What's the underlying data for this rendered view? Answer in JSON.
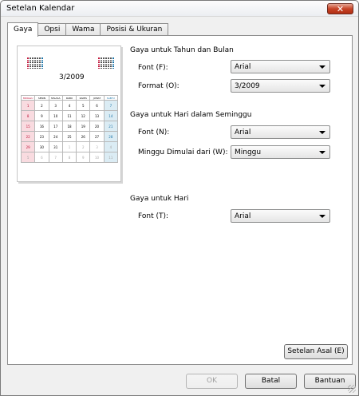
{
  "window": {
    "title": "Setelan Kalendar",
    "close_label": "✕"
  },
  "tabs": [
    "Gaya",
    "Opsi",
    "Wama",
    "Posisi & Ukuran"
  ],
  "preview": {
    "month_title": "3/2009",
    "weekdays": [
      "MINGGU",
      "SENIN",
      "SELASA",
      "RABU",
      "KAMIS",
      "JUMAT",
      "SABTU"
    ],
    "weeks": [
      [
        "1",
        "2",
        "3",
        "4",
        "5",
        "6",
        "7"
      ],
      [
        "8",
        "9",
        "10",
        "11",
        "12",
        "13",
        "14"
      ],
      [
        "15",
        "16",
        "17",
        "18",
        "19",
        "20",
        "21"
      ],
      [
        "22",
        "23",
        "24",
        "25",
        "26",
        "27",
        "28"
      ],
      [
        "29",
        "30",
        "31",
        "1",
        "2",
        "3",
        "4"
      ],
      [
        "5",
        "6",
        "7",
        "8",
        "9",
        "10",
        "11"
      ]
    ],
    "colors": {
      "sunday": "#c0163a",
      "saturday": "#1a74a8"
    }
  },
  "year_month": {
    "section_title": "Gaya untuk Tahun dan Bulan",
    "font_label": "Font (F):",
    "font_value": "Arial",
    "format_label": "Format (O):",
    "format_value": "3/2009"
  },
  "week_days": {
    "section_title": "Gaya untuk Hari dalam Seminggu",
    "font_label": "Font (N):",
    "font_value": "Arial",
    "start_label": "Minggu Dimulai dari (W):",
    "start_value": "Minggu"
  },
  "day": {
    "section_title": "Gaya untuk Hari",
    "font_label": "Font (T):",
    "font_value": "Arial"
  },
  "buttons": {
    "defaults": "Setelan Asal (E)",
    "ok": "OK",
    "cancel": "Batal",
    "help": "Bantuan"
  }
}
